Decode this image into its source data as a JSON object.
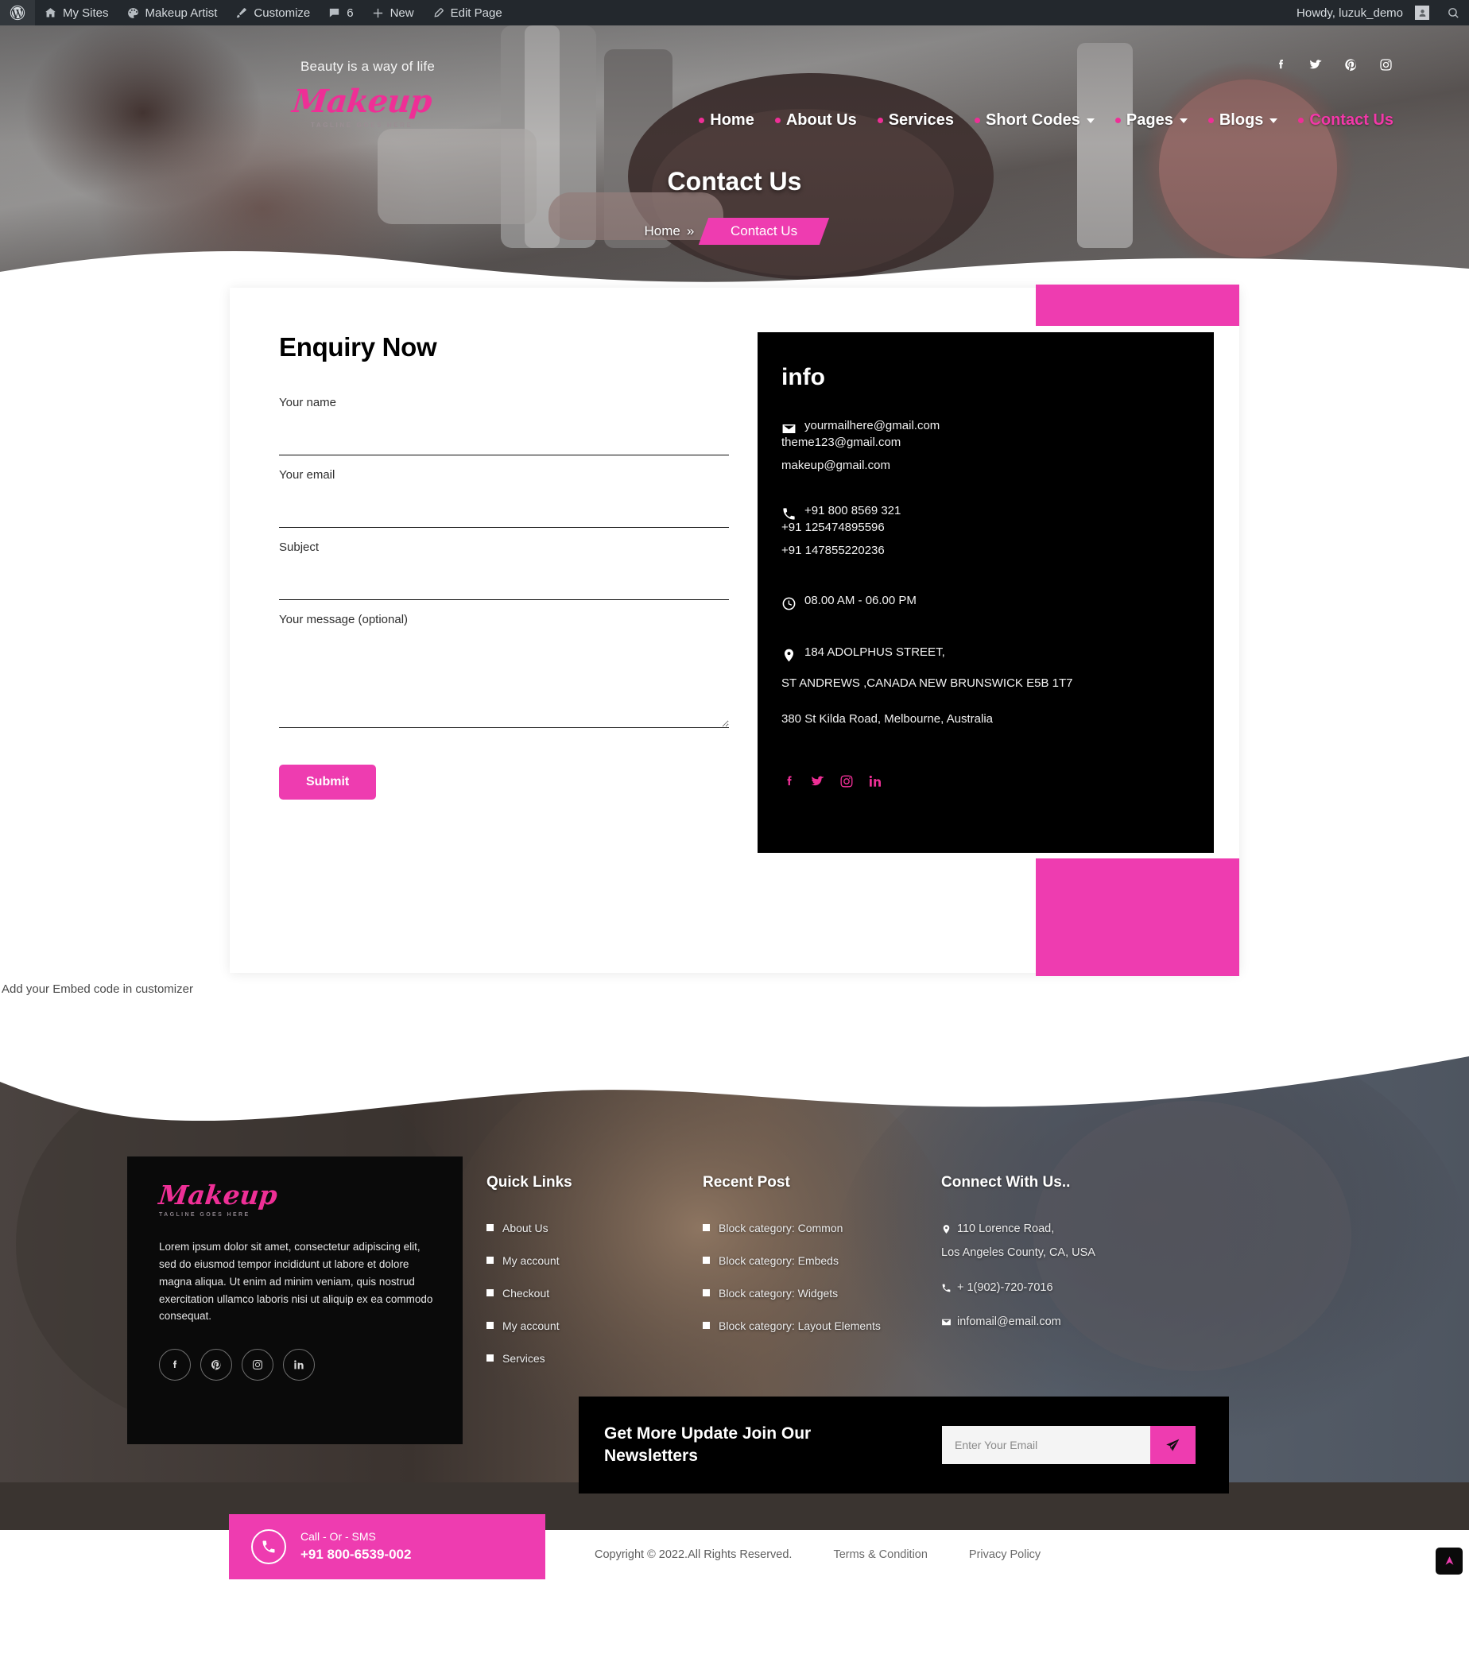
{
  "admin_bar": {
    "items": [
      {
        "icon": "wordpress-icon",
        "label": ""
      },
      {
        "icon": "sites-icon",
        "label": "My Sites"
      },
      {
        "icon": "palette-icon",
        "label": "Makeup Artist"
      },
      {
        "icon": "brush-icon",
        "label": "Customize"
      },
      {
        "icon": "comment-icon",
        "label": "6"
      },
      {
        "icon": "plus-icon",
        "label": "New"
      },
      {
        "icon": "pencil-icon",
        "label": "Edit Page"
      }
    ],
    "howdy": "Howdy, luzuk_demo",
    "search_icon": "search-icon"
  },
  "header": {
    "tagline": "Beauty is a way of life",
    "logo": {
      "word": "Makeup",
      "tag": "TAGLINE GOES HERE"
    },
    "social": [
      "facebook-icon",
      "twitter-icon",
      "pinterest-icon",
      "instagram-icon"
    ],
    "nav": [
      {
        "label": "Home",
        "has_caret": false,
        "active": false
      },
      {
        "label": "About Us",
        "has_caret": false,
        "active": false
      },
      {
        "label": "Services",
        "has_caret": false,
        "active": false
      },
      {
        "label": "Short Codes",
        "has_caret": true,
        "active": false
      },
      {
        "label": "Pages",
        "has_caret": true,
        "active": false
      },
      {
        "label": "Blogs",
        "has_caret": true,
        "active": false
      },
      {
        "label": "Contact Us",
        "has_caret": false,
        "active": true
      }
    ]
  },
  "banner": {
    "title": "Contact Us",
    "crumb_home": "Home",
    "crumb_sep": "»",
    "crumb_current": "Contact Us"
  },
  "form": {
    "title": "Enquiry Now",
    "name_label": "Your name",
    "name_value": "",
    "email_label": "Your email",
    "email_value": "",
    "subject_label": "Subject",
    "subject_value": "",
    "message_label": "Your message (optional)",
    "message_value": "",
    "submit_label": "Submit"
  },
  "info": {
    "title": "info",
    "emails": [
      "yourmailhere@gmail.com",
      "theme123@gmail.com",
      "makeup@gmail.com"
    ],
    "phones": [
      "+91 800 8569 321",
      "+91 125474895596",
      "+91 147855220236"
    ],
    "hours": "08.00 AM - 06.00 PM",
    "address_line1": "184 ADOLPHUS STREET,",
    "address_line2": "ST ANDREWS ,CANADA NEW BRUNSWICK E5B 1T7",
    "address_line3": "380 St Kilda Road, Melbourne, Australia",
    "social": [
      "facebook-icon",
      "twitter-icon",
      "instagram-icon",
      "linkedin-icon"
    ]
  },
  "embed_note": "Add your Embed code in customizer",
  "footer": {
    "about": {
      "logo_word": "Makeup",
      "logo_tag": "TAGLINE GOES HERE",
      "text": "Lorem ipsum dolor sit amet, consectetur adipiscing elit, sed do eiusmod tempor incididunt ut labore et dolore magna aliqua. Ut enim ad minim veniam, quis nostrud exercitation ullamco laboris nisi ut aliquip ex ea commodo consequat.",
      "social": [
        "facebook-icon",
        "pinterest-icon",
        "instagram-icon",
        "linkedin-icon"
      ]
    },
    "quick_links": {
      "title": "Quick Links",
      "items": [
        "About Us",
        "My account",
        "Checkout",
        "My account",
        "Services"
      ]
    },
    "recent_post": {
      "title": "Recent Post",
      "items": [
        "Block category: Common",
        "Block category: Embeds",
        "Block category: Widgets",
        "Block category: Layout Elements"
      ]
    },
    "connect": {
      "title": "Connect With Us..",
      "address_line1": "110 Lorence Road,",
      "address_line2": "Los Angeles County, CA, USA",
      "phone": "+ 1(902)-720-7016",
      "email": "infomail@email.com"
    },
    "newsletter": {
      "title": "Get More Update Join Our Newsletters",
      "placeholder": "Enter Your Email",
      "value": "",
      "send_icon": "send-icon"
    }
  },
  "bottom": {
    "call_label": "Call - Or - SMS",
    "call_number": "+91 800-6539-002",
    "copyright": "Copyright © 2022.All Rights Reserved.",
    "links": [
      "Terms & Condition",
      "Privacy Policy"
    ],
    "to_top_icon": "arrow-up-icon"
  },
  "colors": {
    "accent_pink": "#ee3cb0",
    "logo_pink": "#ee2f96",
    "dark": "#000000",
    "admin_bar": "#23282d"
  }
}
